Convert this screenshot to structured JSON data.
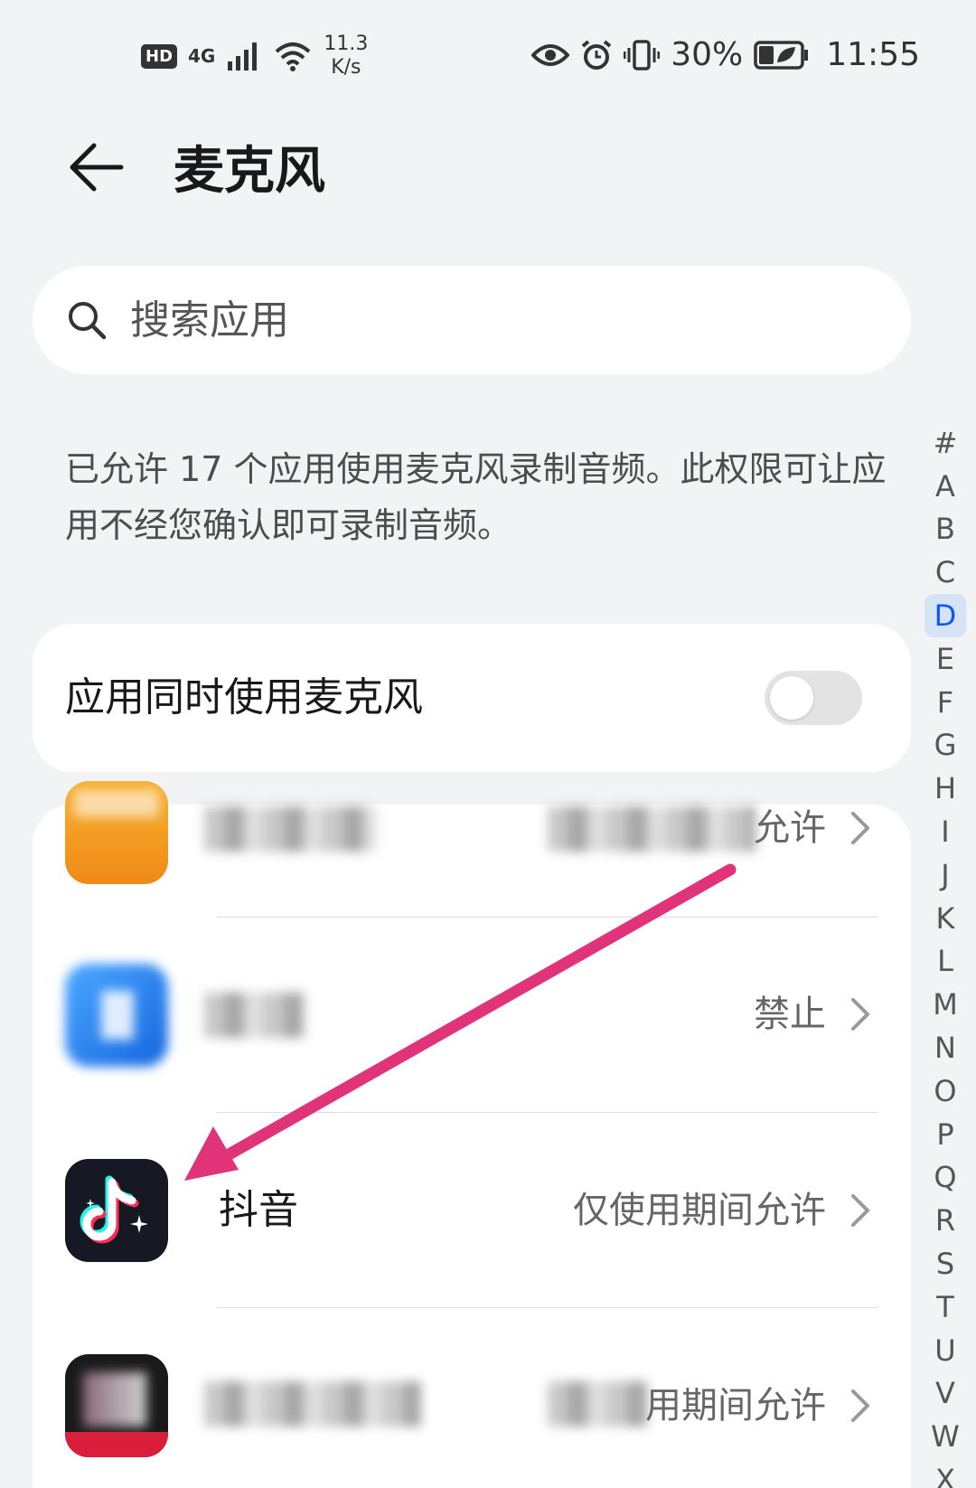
{
  "status_bar": {
    "hd": "HD",
    "network": "4G",
    "speed_value": "11.3",
    "speed_unit": "K/s",
    "battery": "30%",
    "time": "11:55"
  },
  "header": {
    "title": "麦克风"
  },
  "search": {
    "placeholder": "搜索应用"
  },
  "description": "已允许 17 个应用使用麦克风录制音频。此权限可让应用不经您确认即可录制音频。",
  "toggle": {
    "label": "应用同时使用麦克风",
    "on": false
  },
  "alpha_index": {
    "letters": [
      "#",
      "A",
      "B",
      "C",
      "D",
      "E",
      "F",
      "G",
      "H",
      "I",
      "J",
      "K",
      "L",
      "M",
      "N",
      "O",
      "P",
      "Q",
      "R",
      "S",
      "T",
      "U",
      "V",
      "W",
      "X"
    ],
    "active": "D"
  },
  "apps": [
    {
      "name": "",
      "status": "允许",
      "icon": "orange-app-icon"
    },
    {
      "name": "",
      "status": "禁止",
      "icon": "blue-app-icon"
    },
    {
      "name": "抖音",
      "status": "仅使用期间允许",
      "icon": "douyin-icon"
    },
    {
      "name": "",
      "status": "用期间允许",
      "icon": "dark-app-icon"
    }
  ],
  "colors": {
    "background": "#f1f3f5",
    "card": "#ffffff",
    "accent": "#0a59f7",
    "arrow": "#e0337a"
  }
}
